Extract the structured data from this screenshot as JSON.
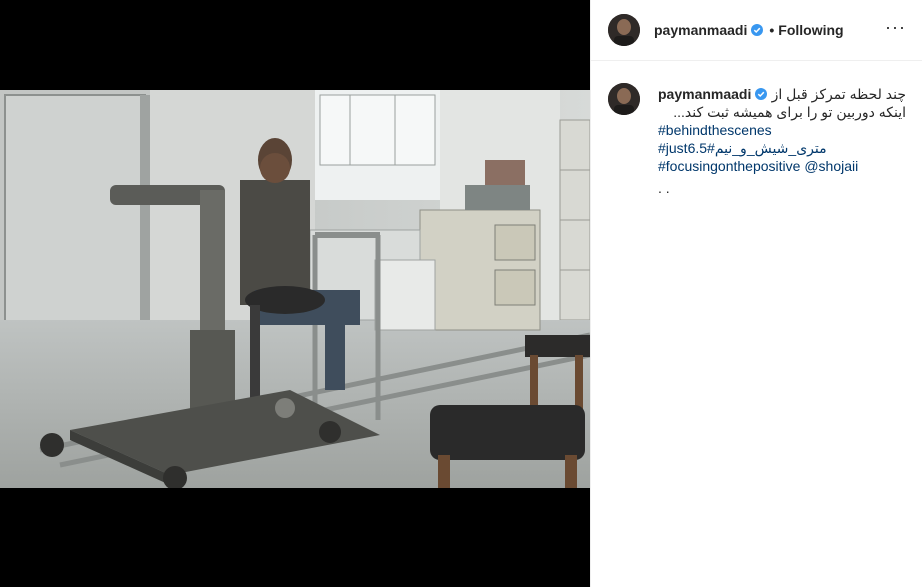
{
  "post": {
    "username": "paymanmaadi",
    "follow_status": "Following",
    "separator": "•",
    "more_label": "···"
  },
  "caption": {
    "username": "paymanmaadi",
    "line1": "چند لحظه تمرکز قبل از",
    "line2": "اینکه دوربین تو را برای همیشه ثبت کند...",
    "hashtags": [
      "#behindthescenes",
      "#just6.5#متری_شیش_و_نیم",
      "#focusingonthepositive @shojaii"
    ],
    "tail": ". ."
  },
  "icons": {
    "verified": "verified-badge-icon",
    "more": "more-options-icon"
  },
  "colors": {
    "verified": "#3897f0",
    "hashtag": "#00376b",
    "text": "#262626",
    "divider": "#efefef"
  }
}
